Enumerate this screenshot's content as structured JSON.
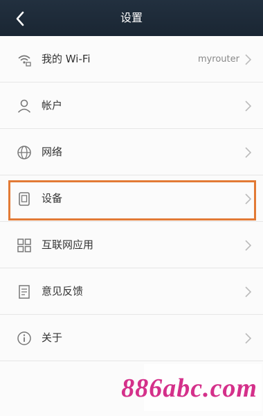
{
  "header": {
    "title": "设置",
    "back_icon": "chevron-left-icon"
  },
  "list": {
    "items": [
      {
        "label": "我的 Wi-Fi",
        "value": "myrouter",
        "icon": "wifi-lock-icon"
      },
      {
        "label": "帐户",
        "value": "",
        "icon": "user-icon"
      },
      {
        "label": "网络",
        "value": "",
        "icon": "globe-icon"
      },
      {
        "label": "设备",
        "value": "",
        "icon": "device-icon"
      },
      {
        "label": "互联网应用",
        "value": "",
        "icon": "grid-icon"
      },
      {
        "label": "意见反馈",
        "value": "",
        "icon": "document-icon"
      },
      {
        "label": "关于",
        "value": "",
        "icon": "info-icon"
      }
    ]
  },
  "watermark": "886abc.com",
  "colors": {
    "header": "#1f2b38",
    "highlight": "#e27a35",
    "watermark": "#d4308a"
  }
}
